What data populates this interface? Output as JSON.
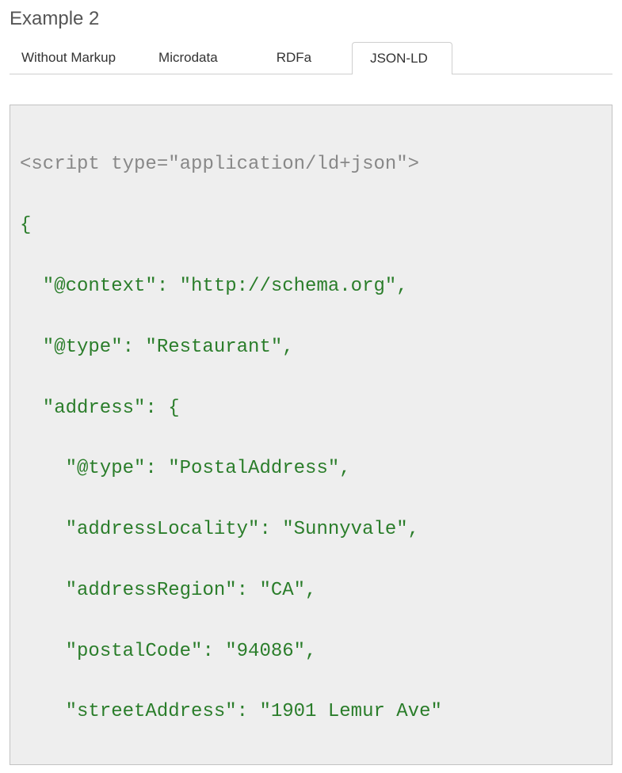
{
  "title": "Example 2",
  "tabs": {
    "t0": "Without Markup",
    "t1": "Microdata",
    "t2": "RDFa",
    "t3": "JSON-LD"
  },
  "code": {
    "l0": "<script type=\"application/ld+json\">",
    "l1": "{",
    "l2": "\"@context\": \"http://schema.org\",",
    "l3": "\"@type\": \"Restaurant\",",
    "l4": "\"address\": {",
    "l5": "\"@type\": \"PostalAddress\",",
    "l6": "\"addressLocality\": \"Sunnyvale\",",
    "l7": "\"addressRegion\": \"CA\",",
    "l8": "\"postalCode\": \"94086\",",
    "l9": "\"streetAddress\": \"1901 Lemur Ave\""
  }
}
